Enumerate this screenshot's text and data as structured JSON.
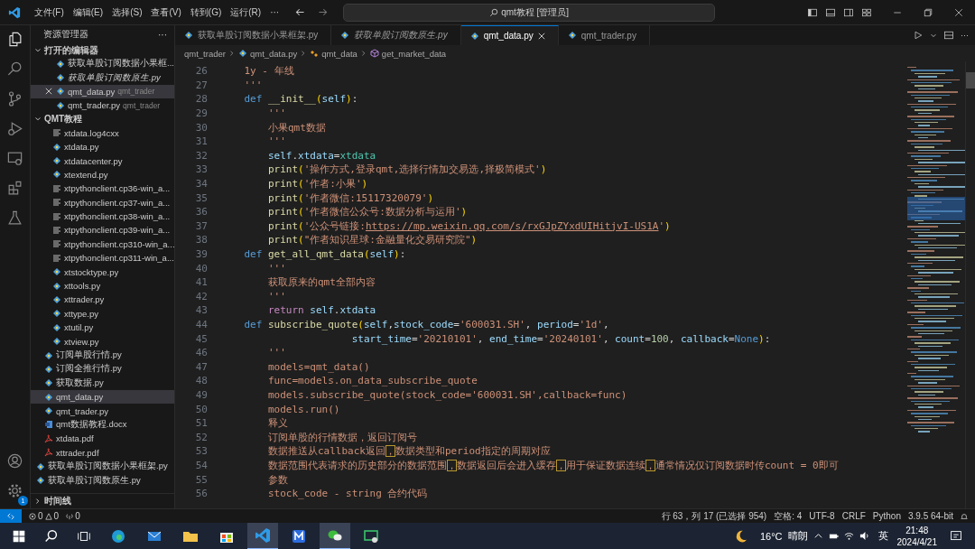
{
  "title_bar": {
    "menus": [
      "文件(F)",
      "编辑(E)",
      "选择(S)",
      "查看(V)",
      "转到(G)",
      "运行(R)",
      "···"
    ],
    "search": "qmt教程 [管理员]"
  },
  "sidebar": {
    "title": "资源管理器",
    "more": "···",
    "open_editors": {
      "title": "打开的编辑器",
      "expanded": true,
      "items": [
        {
          "name": "获取单股订阅数据小果框...",
          "preview": false,
          "selected": false
        },
        {
          "name": "获取单股订阅数原生.py",
          "preview": true,
          "selected": false
        },
        {
          "name": "qmt_data.py",
          "folder": "qmt_trader",
          "preview": false,
          "selected": true
        },
        {
          "name": "qmt_trader.py",
          "folder": "qmt_trader",
          "preview": false,
          "selected": false
        }
      ]
    },
    "tree": [
      {
        "name": "QMT教程",
        "kind": "folder",
        "expanded": true,
        "children": [
          {
            "kind": "group",
            "children": [
              {
                "name": "xtdata.log4cxx",
                "kind": "text",
                "selected": false
              },
              {
                "name": "xtdata.py",
                "kind": "py",
                "selected": false
              },
              {
                "name": "xtdatacenter.py",
                "kind": "py",
                "selected": false
              },
              {
                "name": "xtextend.py",
                "kind": "py",
                "selected": false
              },
              {
                "name": "xtpythonclient.cp36-win_a...",
                "kind": "text",
                "selected": false
              },
              {
                "name": "xtpythonclient.cp37-win_a...",
                "kind": "text",
                "selected": false
              },
              {
                "name": "xtpythonclient.cp38-win_a...",
                "kind": "text",
                "selected": false
              },
              {
                "name": "xtpythonclient.cp39-win_a...",
                "kind": "text",
                "selected": false
              },
              {
                "name": "xtpythonclient.cp310-win_a...",
                "kind": "text",
                "selected": false
              },
              {
                "name": "xtpythonclient.cp311-win_a...",
                "kind": "text",
                "selected": false
              },
              {
                "name": "xtstocktype.py",
                "kind": "py",
                "selected": false
              },
              {
                "name": "xttools.py",
                "kind": "py",
                "selected": false
              },
              {
                "name": "xttrader.py",
                "kind": "py",
                "selected": false
              },
              {
                "name": "xttype.py",
                "kind": "py",
                "selected": false
              },
              {
                "name": "xtutil.py",
                "kind": "py",
                "selected": false
              },
              {
                "name": "xtview.py",
                "kind": "py",
                "selected": false
              }
            ]
          },
          {
            "name": "订阅单股行情.py",
            "kind": "py",
            "selected": false
          },
          {
            "name": "订阅全推行情.py",
            "kind": "py",
            "selected": false
          },
          {
            "name": "获取数据.py",
            "kind": "py",
            "selected": false
          },
          {
            "name": "qmt_data.py",
            "kind": "py",
            "selected": true
          },
          {
            "name": "qmt_trader.py",
            "kind": "py",
            "selected": false
          },
          {
            "name": "qmt数据教程.docx",
            "kind": "docx",
            "selected": false
          },
          {
            "name": "xtdata.pdf",
            "kind": "pdf",
            "selected": false
          },
          {
            "name": "xttrader.pdf",
            "kind": "pdf",
            "selected": false
          }
        ]
      },
      {
        "name": "获取单股订阅数据小果框架.py",
        "kind": "py",
        "selected": false
      },
      {
        "name": "获取单股订阅数原生.py",
        "kind": "py",
        "selected": false
      }
    ],
    "timeline": {
      "title": "时间线",
      "expanded": false
    }
  },
  "activity_bar": {
    "badge": "1"
  },
  "tabs": [
    {
      "label": "获取单股订阅数据小果框架.py",
      "preview": false,
      "selected": false
    },
    {
      "label": "获取单股订阅数原生.py",
      "preview": true,
      "selected": false
    },
    {
      "label": "qmt_data.py",
      "preview": false,
      "selected": true
    },
    {
      "label": "qmt_trader.py",
      "preview": false,
      "selected": false
    }
  ],
  "breadcrumb": [
    {
      "label": "qmt_trader",
      "kind": "folder"
    },
    {
      "label": "qmt_data.py",
      "kind": "py"
    },
    {
      "label": "qmt_data",
      "kind": "class"
    },
    {
      "label": "get_market_data",
      "kind": "method"
    }
  ],
  "code": [
    {
      "num": "26",
      "tokens": [
        {
          "t": "    1y - 年线",
          "kind": "doc"
        }
      ]
    },
    {
      "num": "27",
      "tokens": [
        {
          "t": "    '''",
          "kind": "doc"
        }
      ]
    },
    {
      "num": "28",
      "tokens": [
        {
          "t": "    def",
          "kind": "kw"
        },
        {
          "t": " __init__",
          "kind": "fn"
        },
        {
          "t": "(",
          "kind": "paren"
        },
        {
          "t": "self",
          "kind": "var"
        },
        {
          "t": ")",
          "kind": "paren"
        },
        {
          "t": ":",
          "kind": "plain"
        }
      ]
    },
    {
      "num": "29",
      "tokens": [
        {
          "t": "        '''",
          "kind": "doc"
        }
      ]
    },
    {
      "num": "30",
      "tokens": [
        {
          "t": "        小果qmt数据",
          "kind": "doc"
        }
      ]
    },
    {
      "num": "31",
      "tokens": [
        {
          "t": "        '''",
          "kind": "doc"
        }
      ]
    },
    {
      "num": "32",
      "tokens": [
        {
          "t": "        self",
          "kind": "var"
        },
        {
          "t": ".",
          "kind": "plain"
        },
        {
          "t": "xtdata",
          "kind": "var"
        },
        {
          "t": "=",
          "kind": "plain"
        },
        {
          "t": "xtdata",
          "kind": "cls"
        }
      ]
    },
    {
      "num": "33",
      "tokens": [
        {
          "t": "        print",
          "kind": "fn"
        },
        {
          "t": "(",
          "kind": "paren"
        },
        {
          "t": "'操作方式,登录qmt,选择行情加交易选,择极简模式'",
          "kind": "str"
        },
        {
          "t": ")",
          "kind": "paren"
        }
      ]
    },
    {
      "num": "34",
      "tokens": [
        {
          "t": "        print",
          "kind": "fn"
        },
        {
          "t": "(",
          "kind": "paren"
        },
        {
          "t": "'作者:小果'",
          "kind": "str"
        },
        {
          "t": ")",
          "kind": "paren"
        }
      ]
    },
    {
      "num": "35",
      "tokens": [
        {
          "t": "        print",
          "kind": "fn"
        },
        {
          "t": "(",
          "kind": "paren"
        },
        {
          "t": "'作者微信:15117320079'",
          "kind": "str"
        },
        {
          "t": ")",
          "kind": "paren"
        }
      ]
    },
    {
      "num": "36",
      "tokens": [
        {
          "t": "        print",
          "kind": "fn"
        },
        {
          "t": "(",
          "kind": "paren"
        },
        {
          "t": "'作者微信公众号:数据分析与运用'",
          "kind": "str"
        },
        {
          "t": ")",
          "kind": "paren"
        }
      ]
    },
    {
      "num": "37",
      "tokens": [
        {
          "t": "        print",
          "kind": "fn"
        },
        {
          "t": "(",
          "kind": "paren"
        },
        {
          "t": "'公众号链接:",
          "kind": "str"
        },
        {
          "t": "https://mp.weixin.qq.com/s/rxGJpZYxdUIHitjvI-US1A",
          "kind": "link"
        },
        {
          "t": "'",
          "kind": "str"
        },
        {
          "t": ")",
          "kind": "paren"
        }
      ]
    },
    {
      "num": "38",
      "tokens": [
        {
          "t": "        print",
          "kind": "fn"
        },
        {
          "t": "(",
          "kind": "paren"
        },
        {
          "t": "\"作者知识星球:金融量化交易研究院\"",
          "kind": "str"
        },
        {
          "t": ")",
          "kind": "paren"
        }
      ]
    },
    {
      "num": "39",
      "tokens": [
        {
          "t": "    def",
          "kind": "kw"
        },
        {
          "t": " get_all_qmt_data",
          "kind": "fn"
        },
        {
          "t": "(",
          "kind": "paren"
        },
        {
          "t": "self",
          "kind": "var"
        },
        {
          "t": ")",
          "kind": "paren"
        },
        {
          "t": ":",
          "kind": "plain"
        }
      ]
    },
    {
      "num": "40",
      "tokens": [
        {
          "t": "        '''",
          "kind": "doc"
        }
      ]
    },
    {
      "num": "41",
      "tokens": [
        {
          "t": "        获取原来的qmt全部内容",
          "kind": "doc"
        }
      ]
    },
    {
      "num": "42",
      "tokens": [
        {
          "t": "        '''",
          "kind": "doc"
        }
      ]
    },
    {
      "num": "43",
      "tokens": [
        {
          "t": "        return",
          "kind": "ret"
        },
        {
          "t": " self",
          "kind": "var"
        },
        {
          "t": ".",
          "kind": "plain"
        },
        {
          "t": "xtdata",
          "kind": "var"
        }
      ]
    },
    {
      "num": "44",
      "tokens": [
        {
          "t": "    def",
          "kind": "kw"
        },
        {
          "t": " subscribe_quote",
          "kind": "fn"
        },
        {
          "t": "(",
          "kind": "paren"
        },
        {
          "t": "self",
          "kind": "var"
        },
        {
          "t": ",",
          "kind": "plain"
        },
        {
          "t": "stock_code",
          "kind": "var"
        },
        {
          "t": "=",
          "kind": "plain"
        },
        {
          "t": "'600031.SH'",
          "kind": "str"
        },
        {
          "t": ",",
          "kind": "plain"
        },
        {
          "t": " period",
          "kind": "var"
        },
        {
          "t": "=",
          "kind": "plain"
        },
        {
          "t": "'1d'",
          "kind": "str"
        },
        {
          "t": ",",
          "kind": "plain"
        }
      ]
    },
    {
      "num": "45",
      "tokens": [
        {
          "t": "                      start_time",
          "kind": "var"
        },
        {
          "t": "=",
          "kind": "plain"
        },
        {
          "t": "'20210101'",
          "kind": "str"
        },
        {
          "t": ",",
          "kind": "plain"
        },
        {
          "t": " end_time",
          "kind": "var"
        },
        {
          "t": "=",
          "kind": "plain"
        },
        {
          "t": "'20240101'",
          "kind": "str"
        },
        {
          "t": ",",
          "kind": "plain"
        },
        {
          "t": " count",
          "kind": "var"
        },
        {
          "t": "=",
          "kind": "plain"
        },
        {
          "t": "100",
          "kind": "num"
        },
        {
          "t": ",",
          "kind": "plain"
        },
        {
          "t": " callback",
          "kind": "var"
        },
        {
          "t": "=",
          "kind": "plain"
        },
        {
          "t": "None",
          "kind": "kw"
        },
        {
          "t": ")",
          "kind": "paren"
        },
        {
          "t": ":",
          "kind": "plain"
        }
      ]
    },
    {
      "num": "46",
      "tokens": [
        {
          "t": "        '''",
          "kind": "doc"
        }
      ]
    },
    {
      "num": "47",
      "tokens": [
        {
          "t": "        models=qmt_data()",
          "kind": "doc"
        }
      ]
    },
    {
      "num": "48",
      "tokens": [
        {
          "t": "        func=models.on_data_subscribe_quote",
          "kind": "doc"
        }
      ]
    },
    {
      "num": "49",
      "tokens": [
        {
          "t": "        models.subscribe_quote(stock_code='600031.SH',callback=func)",
          "kind": "doc"
        }
      ]
    },
    {
      "num": "50",
      "tokens": [
        {
          "t": "        models.run()",
          "kind": "doc"
        }
      ]
    },
    {
      "num": "51",
      "tokens": [
        {
          "t": "        释义",
          "kind": "doc"
        }
      ]
    },
    {
      "num": "52",
      "tokens": [
        {
          "t": "        订阅单股的行情数据，返回订阅号",
          "kind": "doc"
        }
      ]
    },
    {
      "num": "53",
      "tokens": [
        {
          "t": "        数据推送从callback返回",
          "kind": "doc"
        },
        {
          "t": "，",
          "kind": "hl"
        },
        {
          "t": "数据类型和period指定的周期对应",
          "kind": "doc"
        }
      ]
    },
    {
      "num": "54",
      "tokens": [
        {
          "t": "        数据范围代表请求的历史部分的数据范围",
          "kind": "doc"
        },
        {
          "t": "，",
          "kind": "hl"
        },
        {
          "t": "数据返回后会进入缓存",
          "kind": "doc"
        },
        {
          "t": "，",
          "kind": "hl"
        },
        {
          "t": "用于保证数据连续",
          "kind": "doc"
        },
        {
          "t": "，",
          "kind": "hl"
        },
        {
          "t": "通常情况仅订阅数据时传count = 0即可",
          "kind": "doc"
        }
      ]
    },
    {
      "num": "55",
      "tokens": [
        {
          "t": "        参数",
          "kind": "doc"
        }
      ]
    },
    {
      "num": "56",
      "tokens": [
        {
          "t": "        stock_code - string 合约代码",
          "kind": "doc"
        }
      ]
    }
  ],
  "status_bar": {
    "errors": "0",
    "warnings": "0",
    "ports": "0",
    "right": [
      "行 63，列 17 (已选择 954)",
      "空格: 4",
      "UTF-8",
      "CRLF",
      "Python",
      "3.9.5 64-bit"
    ]
  },
  "taskbar": {
    "apps": [
      {
        "kind": "edge",
        "active": false
      },
      {
        "kind": "mail",
        "active": false
      },
      {
        "kind": "folder",
        "active": false
      },
      {
        "kind": "store",
        "active": false
      },
      {
        "kind": "vscode",
        "active": true
      },
      {
        "kind": "m-app",
        "active": false
      },
      {
        "kind": "wechat",
        "active": true
      },
      {
        "kind": "monitor",
        "active": false
      }
    ],
    "temperature": "16°C",
    "weather": "晴朗",
    "ime": "英",
    "time": "21:48",
    "date": "2024/4/21"
  }
}
